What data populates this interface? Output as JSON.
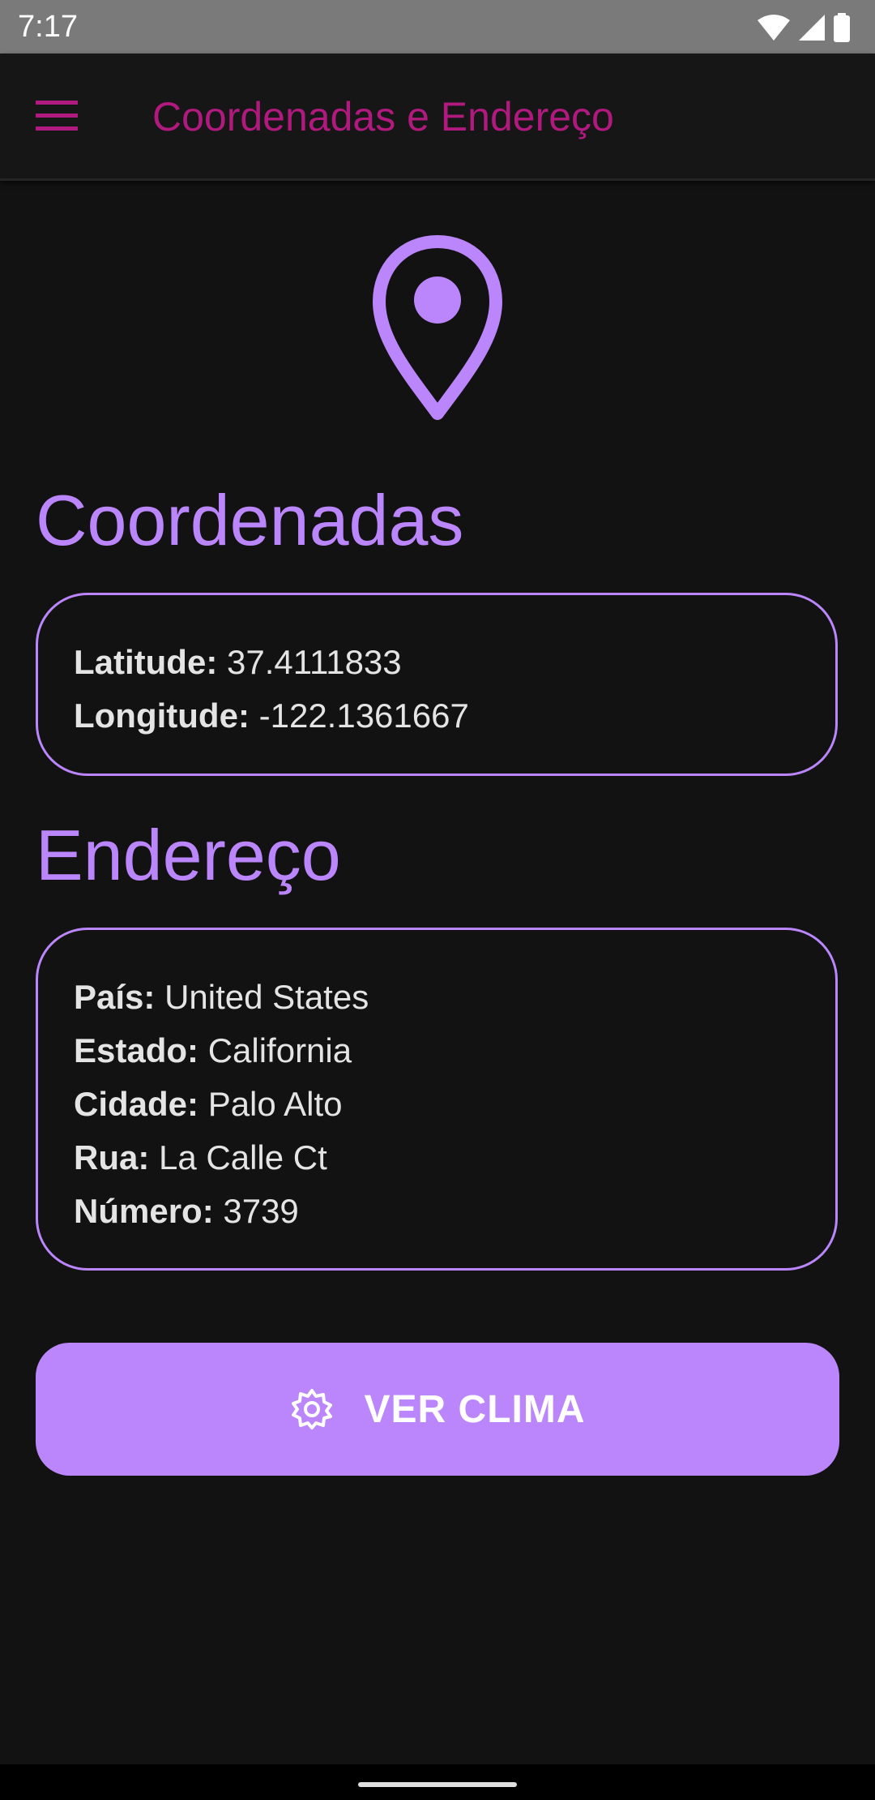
{
  "status_bar": {
    "time": "7:17",
    "icons": [
      "wifi-icon",
      "signal-icon",
      "battery-icon"
    ]
  },
  "app_bar": {
    "title": "Coordenadas e Endereço",
    "menu_icon": "hamburger-menu-icon",
    "title_color": "#b0197d"
  },
  "hero_icon": "location-pin-icon",
  "coordinates": {
    "title": "Coordenadas",
    "latitude_label": "Latitude:",
    "latitude_value": "37.4111833",
    "longitude_label": "Longitude:",
    "longitude_value": "-122.1361667"
  },
  "address": {
    "title": "Endereço",
    "country_label": "País:",
    "country_value": "United States",
    "state_label": "Estado:",
    "state_value": "California",
    "city_label": "Cidade:",
    "city_value": "Palo Alto",
    "street_label": "Rua:",
    "street_value": "La Calle Ct",
    "number_label": "Número:",
    "number_value": "3739"
  },
  "weather_button": {
    "label": "VER CLIMA",
    "icon": "sun-icon"
  },
  "colors": {
    "background": "#121212",
    "accent": "#bb86fc",
    "status_bar": "#7a7a7a"
  }
}
